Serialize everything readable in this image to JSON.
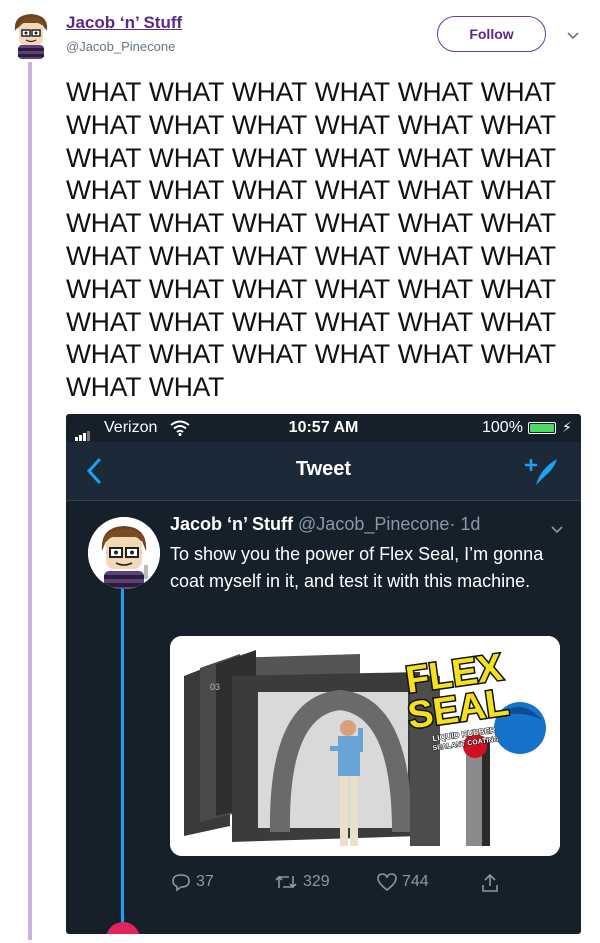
{
  "outer_tweet": {
    "display_name": "Jacob ‘n’ Stuff",
    "handle": "@Jacob_Pinecone",
    "follow_label": "Follow",
    "text": "WHAT WHAT WHAT WHAT WHAT WHAT WHAT WHAT WHAT WHAT WHAT WHAT WHAT WHAT WHAT WHAT WHAT WHAT WHAT WHAT WHAT WHAT WHAT WHAT WHAT WHAT WHAT WHAT WHAT WHAT WHAT WHAT WHAT WHAT WHAT WHAT WHAT WHAT WHAT WHAT WHAT WHAT WHAT WHAT WHAT WHAT WHAT WHAT WHAT WHAT WHAT WHAT WHAT WHAT WHAT WHAT"
  },
  "screenshot": {
    "status_bar": {
      "carrier": "Verizon",
      "time": "10:57 AM",
      "battery": "100%"
    },
    "nav": {
      "title": "Tweet"
    },
    "tweet": {
      "display_name": "Jacob ‘n’ Stuff",
      "handle": "@Jacob_Pinecone",
      "age": "· 1d",
      "text": "To show you the power of Flex Seal, I’m gonna coat myself in it, and test it with this machine.",
      "media": {
        "logo_line1": "FLEX",
        "logo_line2": "SEAL",
        "logo_sub1": "LIQUID RUBBER",
        "logo_sub2": "SEALANT COATING",
        "machine_label": "03"
      },
      "replies": "37",
      "retweets": "329",
      "likes": "744"
    }
  },
  "colors": {
    "accent_purple": "#5b2a86",
    "thread_line": "#c7b2e2",
    "dark_bg": "#15202b",
    "twitter_blue": "#1da1f2"
  }
}
